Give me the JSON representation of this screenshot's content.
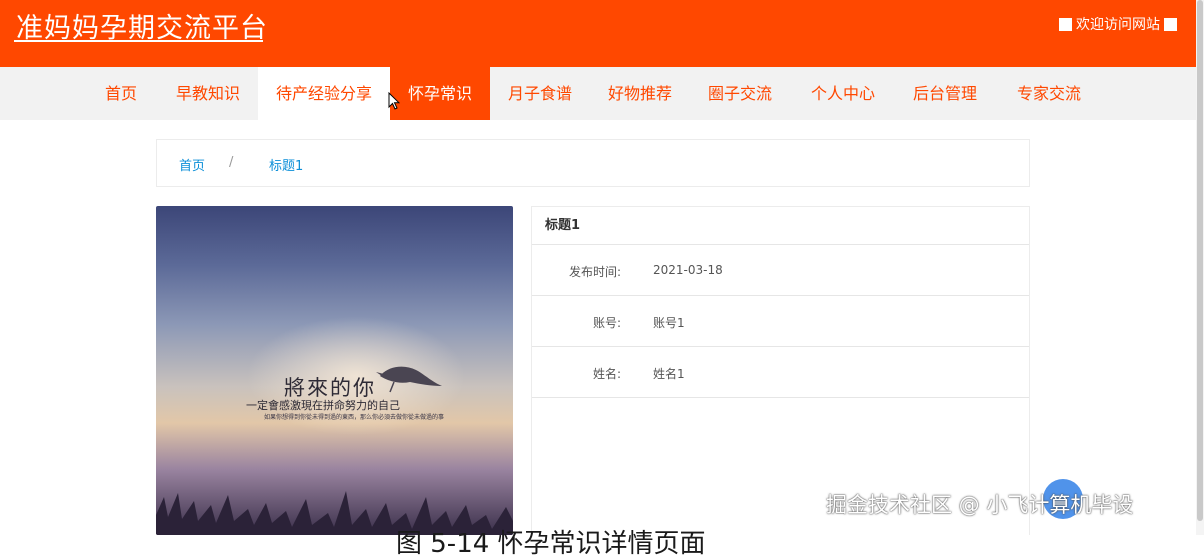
{
  "header": {
    "site_title": "准妈妈孕期交流平台",
    "welcome": "欢迎访问网站"
  },
  "nav": {
    "items": [
      {
        "label": "首页"
      },
      {
        "label": "早教知识"
      },
      {
        "label": "待产经验分享"
      },
      {
        "label": "怀孕常识"
      },
      {
        "label": "月子食谱"
      },
      {
        "label": "好物推荐"
      },
      {
        "label": "圈子交流"
      },
      {
        "label": "个人中心"
      },
      {
        "label": "后台管理"
      },
      {
        "label": "专家交流"
      }
    ],
    "hovered_item": "待产经验分享",
    "active_item": "怀孕常识"
  },
  "breadcrumb": {
    "home": "首页",
    "separator": "/",
    "current": "标题1"
  },
  "image": {
    "title": "將來的你",
    "subtitle": "一定會感激現在拼命努力的自己",
    "fine_print": "如果你想得到你從未得到過的東西，那么你必須去做你從未做過的事"
  },
  "detail": {
    "title": "标题1",
    "rows": [
      {
        "label": "发布时间:",
        "value": "2021-03-18"
      },
      {
        "label": "账号:",
        "value": "账号1"
      },
      {
        "label": "姓名:",
        "value": "姓名1"
      }
    ]
  },
  "watermark": "掘金技术社区 @ 小飞计算机毕设",
  "caption": "图 5-14 怀孕常识详情页面",
  "colors": {
    "brand": "#ff4800",
    "link": "#0c8fd8",
    "nav_bg": "#f2f2f2"
  }
}
